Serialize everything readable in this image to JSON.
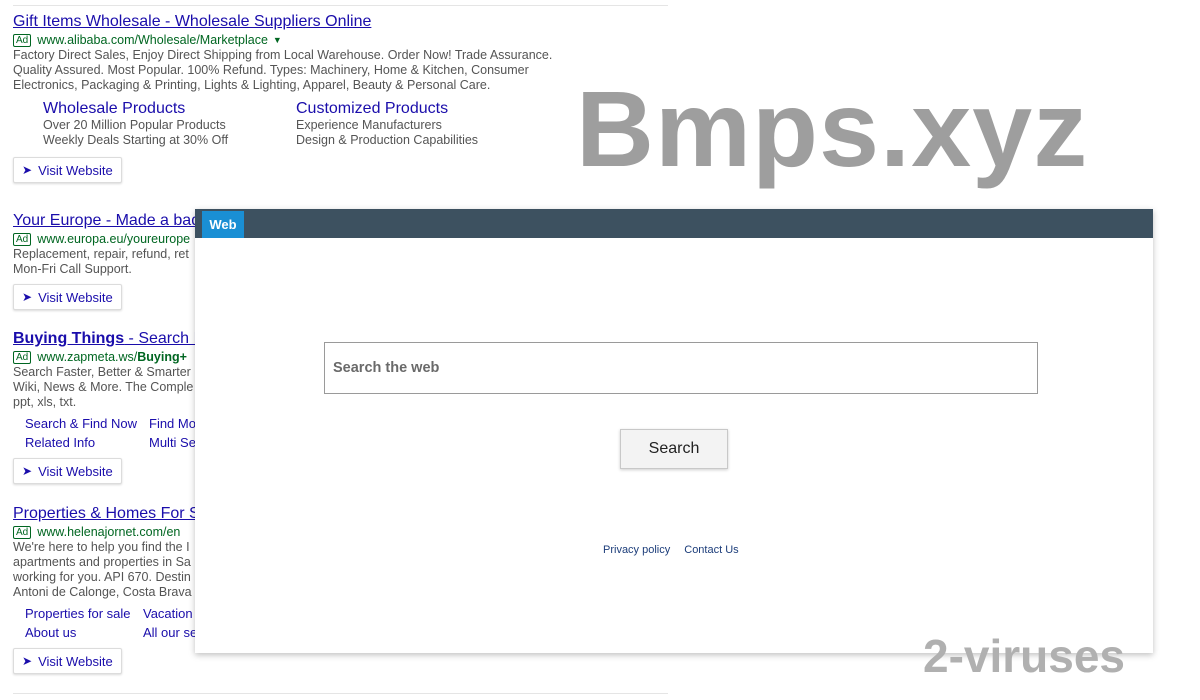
{
  "watermarks": {
    "main": "Bmps.xyz",
    "corner": "2-viruses"
  },
  "ads": [
    {
      "title": "Gift Items Wholesale - Wholesale Suppliers Online",
      "badge": "Ad",
      "url": "www.alibaba.com/Wholesale/Marketplace",
      "desc": "Factory Direct Sales, Enjoy Direct Shipping from Local Warehouse. Order Now! Trade Assurance.\nQuality Assured. Most Popular. 100% Refund. Types: Machinery, Home & Kitchen, Consumer\nElectronics, Packaging & Printing, Lights & Lighting, Apparel, Beauty & Personal Care.",
      "sitelinks": [
        {
          "title": "Wholesale Products",
          "line1": "Over 20 Million Popular Products",
          "line2": "Weekly Deals Starting at 30% Off"
        },
        {
          "title": "Customized Products",
          "line1": "Experience Manufacturers",
          "line2": "Design & Production Capabilities"
        }
      ],
      "visit": "Visit Website"
    },
    {
      "title": "Your Europe - Made a bad",
      "badge": "Ad",
      "url": "www.europa.eu/youreurope",
      "desc": "Replacement, repair, refund, ret\nMon-Fri Call Support.",
      "visit": "Visit Website"
    },
    {
      "title_bold": "Buying Things",
      "title_rest": " - Search I",
      "badge": "Ad",
      "url": "www.zapmeta.ws/",
      "url_bold": "Buying+",
      "desc": "Search Faster, Better & Smarter\nWiki, News & More. The Comple\nppt, xls, txt.",
      "minilinks": [
        "Search & Find Now",
        "Find Mo",
        "Related Info",
        "Multi Se"
      ],
      "visit": "Visit Website"
    },
    {
      "title": "Properties & Homes For S",
      "badge": "Ad",
      "url": "www.helenajornet.com/en",
      "desc": "We're here to help you find the I\napartments and properties in Sa\nworking for you. API 670. Destin\nAntoni de Calonge, Costa Brava",
      "minilinks": [
        "Properties for sale",
        "Vacation",
        "About us",
        "All our se"
      ],
      "visit": "Visit Website"
    }
  ],
  "overlay": {
    "tab_label": "Web",
    "search_placeholder": "Search the web",
    "search_button": "Search",
    "footer": {
      "privacy": "Privacy policy",
      "contact": "Contact Us"
    }
  }
}
